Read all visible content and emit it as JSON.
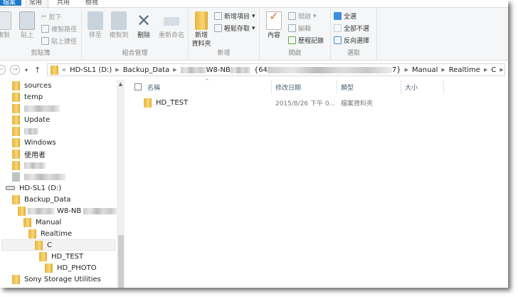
{
  "tabs": [
    "檔案",
    "常用",
    "共用",
    "檢視"
  ],
  "ribbon": {
    "clipboard": {
      "label": "剪貼簿",
      "copy": "複製",
      "paste": "貼上",
      "cut": "剪下",
      "copy_path": "複製路徑",
      "paste_shortcut": "貼上捷徑"
    },
    "organize": {
      "label": "組合管理",
      "move_to": "移至",
      "copy_to": "複製到",
      "delete": "刪除",
      "rename": "重新命名"
    },
    "new": {
      "label": "新增",
      "new_folder": "新增\n資料夾",
      "new_item": "新增項目",
      "easy_access": "輕鬆存取"
    },
    "open": {
      "label": "開啟",
      "properties": "內容",
      "open": "開啟",
      "edit": "編輯",
      "history": "歷程記錄"
    },
    "select": {
      "label": "選取",
      "select_all": "全選",
      "select_none": "全部不選",
      "invert": "反向選擇"
    }
  },
  "address": {
    "overflow": "«",
    "segments": [
      "HD-SL1 (D:)",
      "Backup_Data",
      "W8-NB",
      "{64",
      "7}",
      "Manual",
      "Realtime",
      "C"
    ]
  },
  "nav": {
    "items": [
      "sources",
      "temp",
      "Update",
      "Windows",
      "使用者",
      "HD-SL1 (D:)",
      "Backup_Data",
      "W8-NB",
      "Manual",
      "Realtime",
      "C",
      "HD_TEST",
      "HD_PHOTO",
      "Sony Storage Utilities"
    ]
  },
  "columns": [
    "名稱",
    "修改日期",
    "類型",
    "大小"
  ],
  "files": [
    {
      "name": "HD_TEST",
      "modified": "2015/8/26 下午 0...",
      "type": "檔案資料夾",
      "size": ""
    }
  ]
}
